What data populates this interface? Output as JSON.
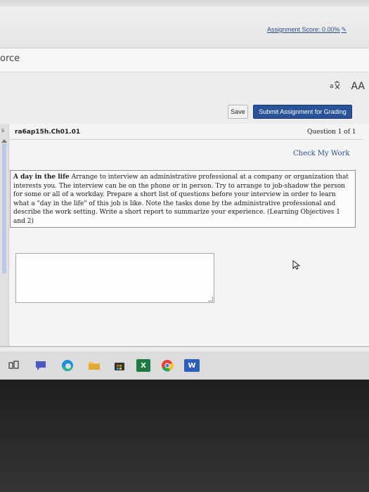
{
  "browser": {
    "site_brand_fragment": "orce"
  },
  "toolbar": {
    "icons": [
      "translate-icon",
      "text-size-icon"
    ],
    "text_size_label": "AA",
    "assignment_score": "Assignment Score: 0.00%",
    "save_label": "Save",
    "submit_label": "Submit Assignment for Grading"
  },
  "question": {
    "doc_id": "ra6ap15h.Ch01.01",
    "question_number": "Question 1 of 1",
    "check_my_work": "Check My Work",
    "title": "A day in the life",
    "body": "Arrange to interview an administrative professional at a company or organization that interests you. The interview can be on the phone or in person. Try to arrange to job-shadow the person for some or all of a workday. Prepare a short list of questions before your interview in order to learn what a \"day in the life\" of this job is like. Note the tasks done by the administrative professional and describe the work setting. Write a short report to summarize your experience. (Learning Objectives 1 and 2)"
  },
  "answer": {
    "value": ""
  },
  "taskbar": {
    "items": [
      "task-view-icon",
      "chat-icon",
      "edge-icon",
      "file-explorer-icon",
      "store-icon",
      "excel-icon",
      "chrome-icon",
      "word-icon"
    ],
    "excel_letter": "X",
    "word_letter": "W"
  },
  "colors": {
    "accent": "#2a5298",
    "link": "#2a4e8a"
  }
}
